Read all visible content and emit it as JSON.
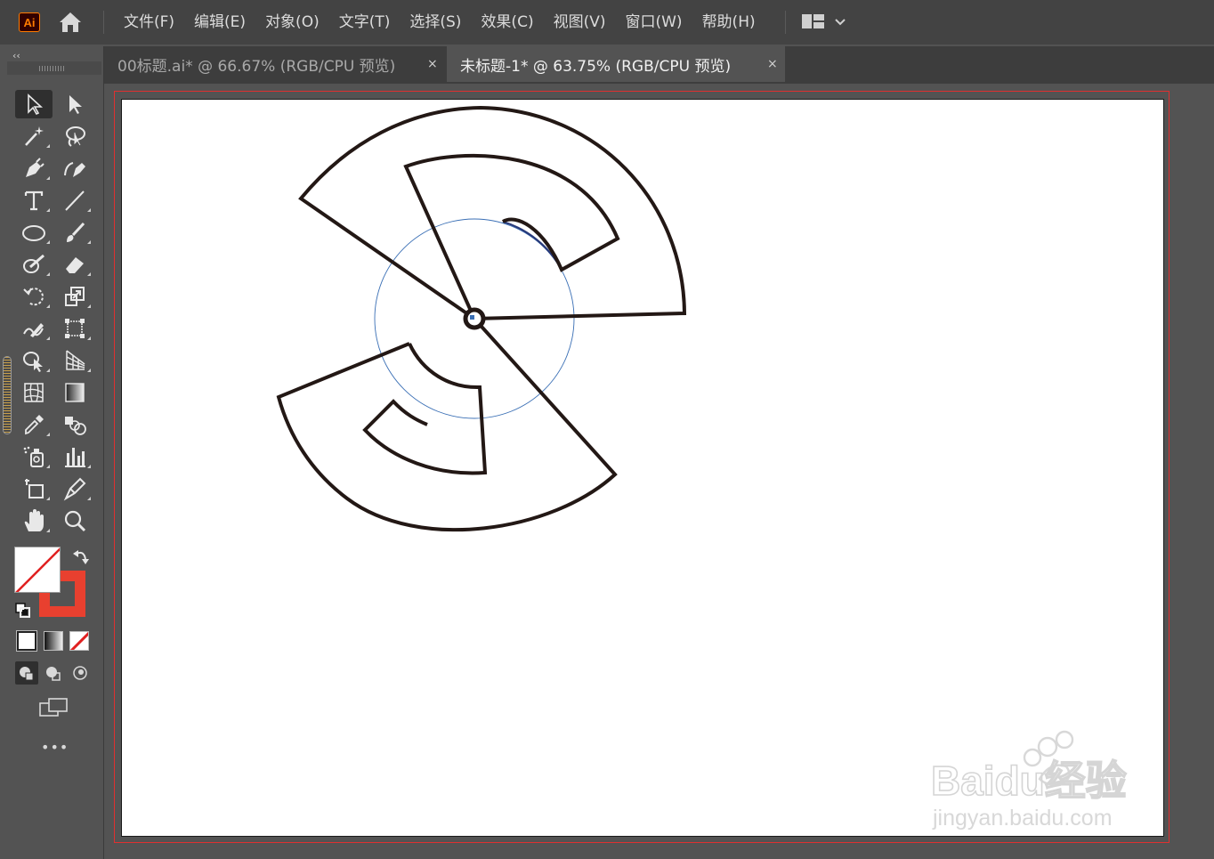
{
  "app": {
    "logo_text": "Ai"
  },
  "menu": {
    "items": [
      {
        "label": "文件(F)"
      },
      {
        "label": "编辑(E)"
      },
      {
        "label": "对象(O)"
      },
      {
        "label": "文字(T)"
      },
      {
        "label": "选择(S)"
      },
      {
        "label": "效果(C)"
      },
      {
        "label": "视图(V)"
      },
      {
        "label": "窗口(W)"
      },
      {
        "label": "帮助(H)"
      }
    ]
  },
  "tabs": [
    {
      "label": "00标题.ai* @ 66.67% (RGB/CPU 预览)",
      "close": "×",
      "active": false
    },
    {
      "label": "未标题-1* @ 63.75% (RGB/CPU 预览)",
      "close": "×",
      "active": true
    }
  ],
  "toolbar": {
    "collapse": "‹‹",
    "more": "•••",
    "tools": [
      "selection-tool",
      "direct-selection-tool",
      "magic-wand-tool",
      "lasso-tool",
      "pen-tool",
      "curvature-tool",
      "type-tool",
      "line-segment-tool",
      "ellipse-tool",
      "paintbrush-tool",
      "shaper-tool",
      "eraser-tool",
      "rotate-tool",
      "scale-tool",
      "warp-tool",
      "free-transform-tool",
      "shape-builder-tool",
      "perspective-grid-tool",
      "mesh-tool",
      "gradient-tool",
      "eyedropper-tool",
      "blend-tool",
      "symbol-sprayer-tool",
      "column-graph-tool",
      "artboard-tool",
      "slice-tool",
      "hand-tool",
      "zoom-tool"
    ],
    "fill": "none",
    "stroke_color": "#e8402f"
  },
  "watermark": {
    "brand": "Baidu经验",
    "url": "jingyan.baidu.com"
  },
  "colors": {
    "stroke": "#231815",
    "guide_circle": "#3a6fb5",
    "bleed": "#e03030"
  }
}
